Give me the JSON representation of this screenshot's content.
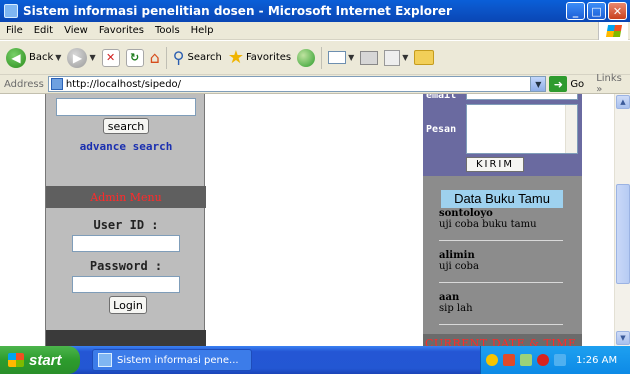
{
  "window": {
    "title": "Sistem informasi penelitian dosen - Microsoft Internet Explorer",
    "minimize": "_",
    "maximize": "□",
    "close": "✕"
  },
  "menu": [
    "File",
    "Edit",
    "View",
    "Favorites",
    "Tools",
    "Help"
  ],
  "toolbar": {
    "back": "Back",
    "search": "Search",
    "favorites": "Favorites"
  },
  "address": {
    "label": "Address",
    "url": "http://localhost/sipedo/",
    "go": "Go",
    "links": "Links"
  },
  "left_panel": {
    "search_button": "search",
    "advance_search": "advance search",
    "admin_menu": "Admin Menu",
    "user_id_label": "User ID :",
    "password_label": "Password :",
    "login_button": "Login"
  },
  "right_panel": {
    "email_label": "email",
    "pesan_label": "Pesan",
    "kirim_button": "KIRIM",
    "guestbook_title": "Data Buku Tamu",
    "entries": [
      {
        "name": "sontoloyo",
        "message": "uji coba buku tamu"
      },
      {
        "name": "alimin",
        "message": "uji coba"
      },
      {
        "name": "aan",
        "message": "sip lah"
      }
    ],
    "current_date_label": "CURRENT DATE & TIME"
  },
  "taskbar": {
    "start": "start",
    "task_label": "Sistem informasi pene...",
    "clock": "1:26 AM"
  }
}
